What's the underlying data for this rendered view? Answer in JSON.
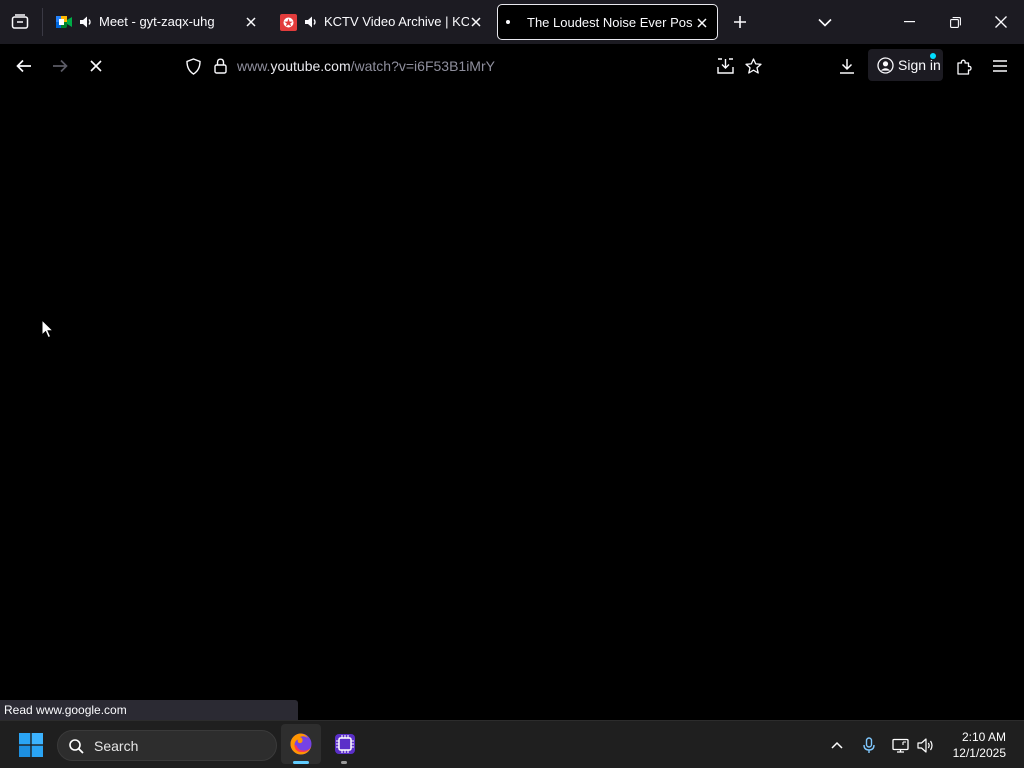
{
  "browser": {
    "tabs": [
      {
        "title": "Meet - gyt-zaqx-uhg",
        "audio": true
      },
      {
        "title": "KCTV Video Archive | KCNA",
        "audio": true
      },
      {
        "title": "The Loudest Noise Ever Possible",
        "active": true,
        "loading": true
      }
    ],
    "url": {
      "prefix": "www.",
      "host": "youtube.com",
      "path": "/watch?v=i6F53B1iMrY"
    },
    "signin_label": "Sign in",
    "status_text": "Read www.google.com"
  },
  "taskbar": {
    "search_placeholder": "Search",
    "clock": {
      "time": "2:10 AM",
      "date": "12/1/2025"
    }
  },
  "colors": {
    "accent": "#00ddff",
    "tabstrip_bg": "#1c1b22",
    "page_bg": "#000000",
    "taskbar_bg": "#1f1f1f"
  },
  "icons": [
    "tab-overview-icon",
    "meet-favicon",
    "speaker-icon",
    "close-icon",
    "kctv-favicon",
    "new-tab-icon",
    "tab-list-chevron-icon",
    "minimize-icon",
    "restore-icon",
    "window-close-icon",
    "back-icon",
    "forward-icon",
    "stop-loading-icon",
    "tracking-shield-icon",
    "lock-icon",
    "save-page-icon",
    "bookmark-star-icon",
    "downloads-icon",
    "account-icon",
    "extensions-icon",
    "menu-icon",
    "windows-start-icon",
    "search-icon",
    "firefox-icon",
    "app-icon",
    "chevron-up-icon",
    "microphone-icon",
    "network-icon",
    "volume-icon"
  ]
}
